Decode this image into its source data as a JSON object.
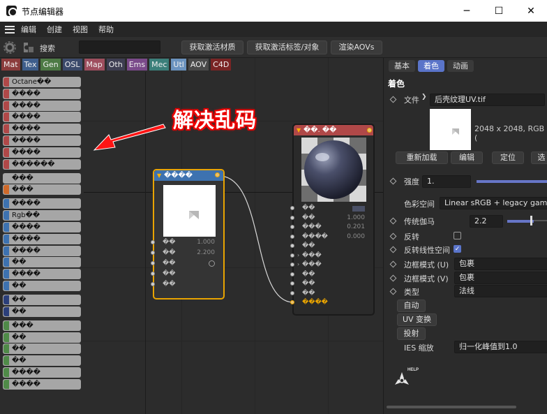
{
  "window": {
    "title": "节点编辑器",
    "minimize": "─",
    "maximize": "☐",
    "close": "✕"
  },
  "menu": [
    "编辑",
    "创建",
    "视图",
    "帮助"
  ],
  "toolbar": {
    "search_label": "搜索",
    "search_value": "",
    "btn_material": "获取激活材质",
    "btn_tag": "获取激活标签/对象",
    "btn_aov": "渲染AOVs"
  },
  "category_tabs": [
    {
      "label": "Mat",
      "color": "#8b3c3c"
    },
    {
      "label": "Tex",
      "color": "#3e5e8c"
    },
    {
      "label": "Gen",
      "color": "#4d7a45"
    },
    {
      "label": "OSL",
      "color": "#3b4a6b"
    },
    {
      "label": "Map",
      "color": "#9e4e5e"
    },
    {
      "label": "Oth",
      "color": "#3e3e52"
    },
    {
      "label": "Ems",
      "color": "#7a4a8a"
    },
    {
      "label": "Mec",
      "color": "#3b7f7a"
    },
    {
      "label": "Utl",
      "color": "#6b93bf"
    },
    {
      "label": "AOV",
      "color": "#4a4a4a"
    },
    {
      "label": "C4D",
      "color": "#7a2424"
    }
  ],
  "node_list": [
    {
      "label": "Octane��",
      "color": "#b04848"
    },
    {
      "label": "����",
      "color": "#b04848"
    },
    {
      "label": "����",
      "color": "#b04848"
    },
    {
      "label": "����",
      "color": "#b04848"
    },
    {
      "label": "����",
      "color": "#b04848"
    },
    {
      "label": "����",
      "color": "#b04848"
    },
    {
      "label": "����",
      "color": "#b04848"
    },
    {
      "label": "������",
      "color": "#b04848"
    },
    {
      "label": "���",
      "color": "#a6a6a6"
    },
    {
      "label": "���",
      "color": "#d06a2a"
    },
    {
      "label": "����",
      "color": "#3d72b0"
    },
    {
      "label": "Rgb��",
      "color": "#3d72b0"
    },
    {
      "label": "����",
      "color": "#3d72b0"
    },
    {
      "label": "����",
      "color": "#3d72b0"
    },
    {
      "label": "����",
      "color": "#3d72b0"
    },
    {
      "label": "��",
      "color": "#3d72b0"
    },
    {
      "label": "����",
      "color": "#3d72b0"
    },
    {
      "label": "��",
      "color": "#3d72b0"
    },
    {
      "label": "��",
      "color": "#2b3f7a"
    },
    {
      "label": "��",
      "color": "#2b3f7a"
    },
    {
      "label": "���",
      "color": "#4f8a48"
    },
    {
      "label": "��",
      "color": "#4f8a48"
    },
    {
      "label": "��",
      "color": "#4f8a48"
    },
    {
      "label": "��",
      "color": "#4f8a48"
    },
    {
      "label": "����",
      "color": "#4f8a48"
    },
    {
      "label": "����",
      "color": "#4f8a48"
    }
  ],
  "annotation": {
    "text": "解决乱码"
  },
  "image_node": {
    "title": "����",
    "rows": [
      {
        "label": "��",
        "value": "1.000"
      },
      {
        "label": "��",
        "value": "2.200"
      },
      {
        "label": "��",
        "value": ""
      },
      {
        "label": "��",
        "value": ""
      },
      {
        "label": "��",
        "value": ""
      }
    ]
  },
  "material_node": {
    "title": "��. ��",
    "rows": [
      {
        "label": "��",
        "value": ""
      },
      {
        "label": "��",
        "value": "1.000"
      },
      {
        "label": "���",
        "value": "0.201"
      },
      {
        "label": "����",
        "value": "0.000"
      },
      {
        "label": "��",
        "value": ""
      },
      {
        "label": "���",
        "value": ""
      },
      {
        "label": "���",
        "value": ""
      },
      {
        "label": "��",
        "value": ""
      },
      {
        "label": "��",
        "value": ""
      },
      {
        "label": "��",
        "value": ""
      },
      {
        "label": "����",
        "value": ""
      }
    ]
  },
  "attributes": {
    "tabs": [
      "基本",
      "着色",
      "动画"
    ],
    "active_tab": "着色",
    "section": "着色",
    "file_label": "文件",
    "file_value": "后壳纹理UV.tif",
    "image_info": "2048 x 2048, RGB (",
    "btn_reload": "重新加载",
    "btn_edit": "编辑",
    "btn_locate": "定位",
    "btn_more": "选",
    "strength_label": "强度",
    "strength_value": "1.",
    "colorspace_label": "色彩空间",
    "colorspace_value": "Linear sRGB + legacy gamm",
    "gamma_label": "传统伽马",
    "gamma_value": "2.2",
    "invert_label": "反转",
    "invert_linear_label": "反转线性空间",
    "border_u_label": "边框模式 (U)",
    "border_u_value": "包裹",
    "border_v_label": "边框模式 (V)",
    "border_v_value": "包裹",
    "type_label": "类型",
    "type_value": "法线",
    "btn_auto": "自动",
    "btn_uv": "UV 变换",
    "btn_projection": "投射",
    "ies_label": "IES 缩放",
    "ies_value": "归一化峰值到1.0",
    "help_label": "HELP"
  }
}
